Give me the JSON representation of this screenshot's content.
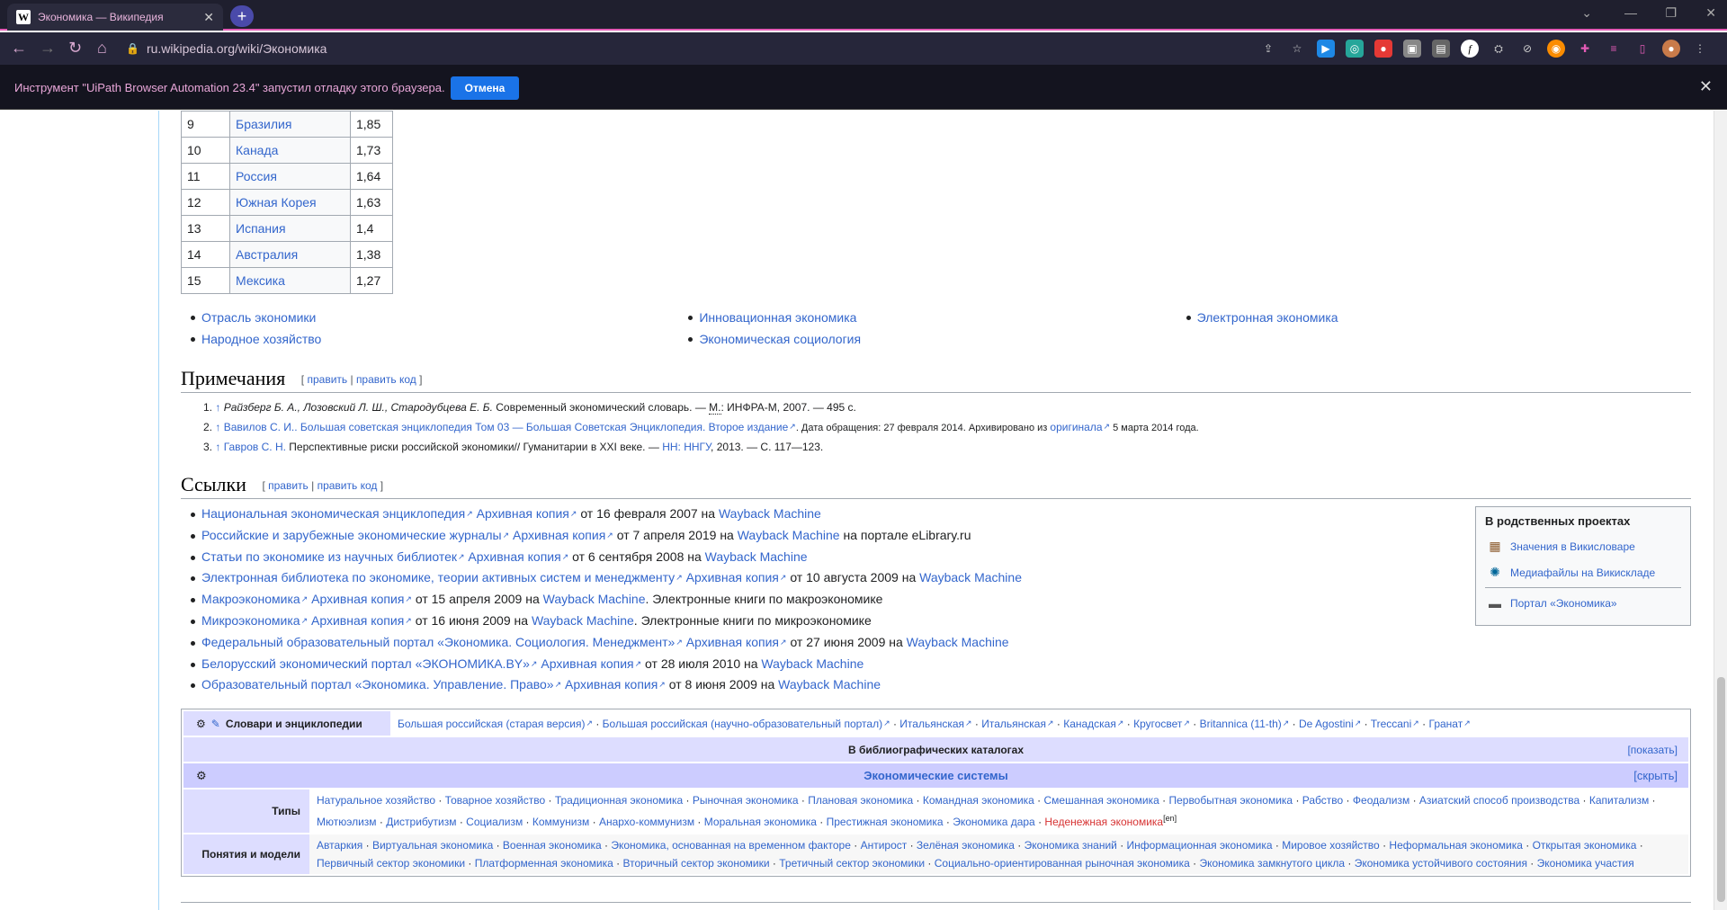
{
  "browser": {
    "tab_title": "Экономика — Википедия",
    "url": "ru.wikipedia.org/wiki/Экономика",
    "infobar_message": "Инструмент \"UiPath Browser Automation 23.4\" запустил отладку этого браузера.",
    "infobar_button": "Отмена"
  },
  "ranking_table": {
    "rows": [
      {
        "rank": "9",
        "country": "Бразилия",
        "value": "1,85"
      },
      {
        "rank": "10",
        "country": "Канада",
        "value": "1,73"
      },
      {
        "rank": "11",
        "country": "Россия",
        "value": "1,64"
      },
      {
        "rank": "12",
        "country": "Южная Корея",
        "value": "1,63"
      },
      {
        "rank": "13",
        "country": "Испания",
        "value": "1,4"
      },
      {
        "rank": "14",
        "country": "Австралия",
        "value": "1,38"
      },
      {
        "rank": "15",
        "country": "Мексика",
        "value": "1,27"
      }
    ]
  },
  "see_also": {
    "col1": [
      "Отрасль экономики",
      "Народное хозяйство"
    ],
    "col2": [
      "Инновационная экономика",
      "Экономическая социология"
    ],
    "col3": [
      "Электронная экономика"
    ]
  },
  "notes_section": {
    "title": "Примечания",
    "edit": "править",
    "edit_code": "править код",
    "items": [
      {
        "arrow": "↑",
        "authors": "Райзберг Б. А., Лозовский Л. Ш., Стародубцева Е. Б.",
        "text": " Современный экономический словарь. — ",
        "m": "М.",
        "rest": ": ИНФРА-М, 2007. — 495 с."
      },
      {
        "arrow": "↑",
        "link": "Вавилов С. И.. Большая советская энциклопедия Том 03 — Большая Советская Энциклопедия. Второе издание",
        "text": ". Дата обращения: 27 февраля 2014. Архивировано из ",
        "link2": "оригинала",
        "rest": " 5 марта 2014 года."
      },
      {
        "arrow": "↑",
        "link": "Гавров С. Н.",
        "text": " Перспективные риски российской экономики// Гуманитарии в XXI веке. — ",
        "link2": "НН: ННГУ",
        "rest": ", 2013. — С. 117—123."
      }
    ]
  },
  "links_section": {
    "title": "Ссылки",
    "edit": "править",
    "edit_code": "править код",
    "items": [
      {
        "link": "Национальная экономическая энциклопедия",
        "arch": "Архивная копия",
        "date": " от 16 февраля 2007 на ",
        "wm": "Wayback Machine",
        "tail": ""
      },
      {
        "link": "Российские и зарубежные экономические журналы",
        "arch": "Архивная копия",
        "date": " от 7 апреля 2019 на ",
        "wm": "Wayback Machine",
        "tail": " на портале eLibrary.ru"
      },
      {
        "link": "Статьи по экономике из научных библиотек",
        "arch": "Архивная копия",
        "date": " от 6 сентября 2008 на ",
        "wm": "Wayback Machine",
        "tail": ""
      },
      {
        "link": "Электронная библиотека по экономике, теории активных систем и менеджменту",
        "arch": "Архивная копия",
        "date": " от 10 августа 2009 на ",
        "wm": "Wayback Machine",
        "tail": ""
      },
      {
        "link": "Макроэкономика",
        "arch": "Архивная копия",
        "date": " от 15 апреля 2009 на ",
        "wm": "Wayback Machine",
        "tail": ". Электронные книги по макроэкономике"
      },
      {
        "link": "Микроэкономика",
        "arch": "Архивная копия",
        "date": " от 16 июня 2009 на ",
        "wm": "Wayback Machine",
        "tail": ". Электронные книги по микроэкономике"
      },
      {
        "link": "Федеральный образовательный портал «Экономика. Социология. Менеджмент»",
        "arch": "Архивная копия",
        "date": " от 27 июня 2009 на ",
        "wm": "Wayback Machine",
        "tail": ""
      },
      {
        "link": "Белорусский экономический портал «ЭКОНОМИКА.BY»",
        "arch": "Архивная копия",
        "date": " от 28 июля 2010 на ",
        "wm": "Wayback Machine",
        "tail": ""
      },
      {
        "link": "Образовательный портал «Экономика. Управление. Право»",
        "arch": "Архивная копия",
        "date": " от 8 июня 2009 на ",
        "wm": "Wayback Machine",
        "tail": ""
      }
    ]
  },
  "sister_projects": {
    "title": "В родственных проектах",
    "wiktionary": "Значения в Викисловаре",
    "commons": "Медиафайлы на Викискладе",
    "portal": "Портал «Экономика»"
  },
  "navbox": {
    "dict_label": "Словари и энциклопедии",
    "dict_links": [
      "Большая российская (старая версия)",
      "Большая российская (научно-образовательный портал)",
      "Итальянская",
      "Итальянская",
      "Канадская",
      "Кругосвет",
      "Britannica (11-th)",
      "De Agostini",
      "Treccani",
      "Гранат"
    ],
    "bib_title": "В библиографических каталогах",
    "bib_toggle": "[показать]",
    "systems_title": "Экономические системы",
    "systems_toggle": "[скрыть]",
    "types_label": "Типы",
    "types": [
      "Натуральное хозяйство",
      "Товарное хозяйство",
      "Традиционная экономика",
      "Рыночная экономика",
      "Плановая экономика",
      "Командная экономика",
      "Смешанная экономика",
      "Первобытная экономика",
      "Рабство",
      "Феодализм",
      "Азиатский способ производства",
      "Капитализм",
      "Мютюэлизм",
      "Дистрибутизм",
      "Социализм",
      "Коммунизм",
      "Анархо-коммунизм",
      "Моральная экономика",
      "Престижная экономика",
      "Экономика дара"
    ],
    "types_red": "Неденежная экономика",
    "types_red_sup": "[en]",
    "concepts_label": "Понятия и модели",
    "concepts": [
      "Автаркия",
      "Виртуальная экономика",
      "Военная экономика",
      "Экономика, основанная на временном факторе",
      "Антирост",
      "Зелёная экономика",
      "Экономика знаний",
      "Информационная экономика",
      "Мировое хозяйство",
      "Неформальная экономика",
      "Открытая экономика",
      "Первичный сектор экономики",
      "Платформенная экономика",
      "Вторичный сектор экономики",
      "Третичный сектор экономики",
      "Социально-ориентированная рыночная экономика",
      "Экономика замкнутого цикла",
      "Экономика устойчивого состояния",
      "Экономика участия"
    ]
  }
}
